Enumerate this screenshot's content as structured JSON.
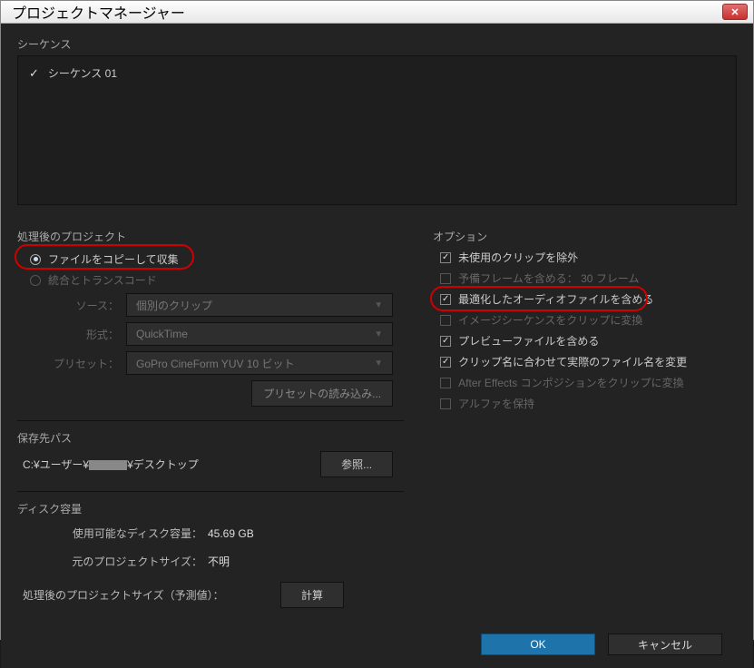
{
  "title": "プロジェクトマネージャー",
  "sequence": {
    "label": "シーケンス",
    "items": [
      "シーケンス 01"
    ]
  },
  "result_project": {
    "label": "処理後のプロジェクト",
    "radio_copy": "ファイルをコピーして収集",
    "radio_transcode": "統合とトランスコード",
    "source_label": "ソース：",
    "source_value": "個別のクリップ",
    "format_label": "形式：",
    "format_value": "QuickTime",
    "preset_label": "プリセット：",
    "preset_value": "GoPro CineForm YUV 10 ビット",
    "preset_load": "プリセットの読み込み..."
  },
  "destination": {
    "label": "保存先パス",
    "path_prefix": "C:¥ユーザー¥",
    "path_suffix": "¥デスクトップ",
    "browse": "参照..."
  },
  "disk": {
    "label": "ディスク容量",
    "avail_label": "使用可能なディスク容量：",
    "avail_value": "45.69 GB",
    "orig_label": "元のプロジェクトサイズ：",
    "orig_value": "不明",
    "result_label": "処理後のプロジェクトサイズ（予測値）：",
    "calc": "計算"
  },
  "options": {
    "label": "オプション",
    "items": [
      {
        "label": "未使用のクリップを除外",
        "checked": true,
        "enabled": true
      },
      {
        "label": "予備フレームを含める： 30  フレーム",
        "checked": false,
        "enabled": false
      },
      {
        "label": "最適化したオーディオファイルを含める",
        "checked": true,
        "enabled": true
      },
      {
        "label": "イメージシーケンスをクリップに変換",
        "checked": false,
        "enabled": false
      },
      {
        "label": "プレビューファイルを含める",
        "checked": true,
        "enabled": true
      },
      {
        "label": "クリップ名に合わせて実際のファイル名を変更",
        "checked": true,
        "enabled": true
      },
      {
        "label": "After Effects コンポジションをクリップに変換",
        "checked": false,
        "enabled": false
      },
      {
        "label": "アルファを保持",
        "checked": false,
        "enabled": false
      }
    ]
  },
  "footer": {
    "ok": "OK",
    "cancel": "キャンセル"
  }
}
